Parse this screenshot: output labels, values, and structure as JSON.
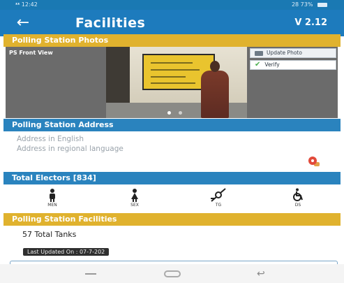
{
  "status_bar": {
    "left": "ᵜᵜ 12:42",
    "right": "28 73% "
  },
  "app_bar": {
    "title": "Facilities",
    "version": "V 2.12"
  },
  "sections": {
    "photos": "Polling Station Photos",
    "address": "Polling Station Address",
    "electors": "Total Electors [834]",
    "facilities": "Polling Station Facilities"
  },
  "photo": {
    "label": "PS Front View",
    "update_label": "Update Photo",
    "verify_label": "Verify"
  },
  "address": {
    "english": "Address in English",
    "regional": "Address in regional language"
  },
  "electors": [
    {
      "icon": "male-icon",
      "label": "MEN"
    },
    {
      "icon": "female-icon",
      "label": "SEX"
    },
    {
      "icon": "transgender-icon",
      "label": "TG"
    },
    {
      "icon": "wheelchair-icon",
      "label": "DS"
    }
  ],
  "facilities": {
    "tanks": "57 Total Tanks",
    "updated": "Last Updated On : 07-7-202"
  },
  "colors": {
    "primary": "#1d7bbd",
    "accent": "#e0b22e"
  }
}
